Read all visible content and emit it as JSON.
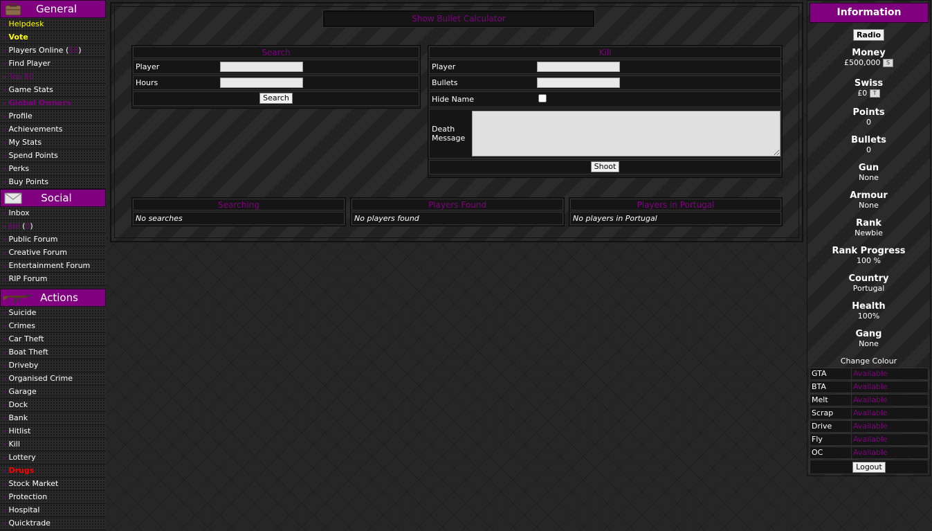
{
  "sidebar": {
    "general": {
      "title": "General",
      "items": {
        "helpdesk": "Helpdesk",
        "vote": "Vote",
        "players_online": "Players Online (",
        "players_online_count": "16",
        "players_online_close": ")",
        "find_player": "Find Player",
        "top10": "Top 10",
        "game_stats": "Game Stats",
        "global_owners": "Global Owners",
        "profile": "Profile",
        "achievements": "Achievements",
        "my_stats": "My Stats",
        "spend_points": "Spend Points",
        "perks": "Perks",
        "buy_points": "Buy Points"
      }
    },
    "social": {
      "title": "Social",
      "items": {
        "inbox": "Inbox",
        "jail": "Jail",
        "jail_open": " (",
        "jail_count": "0",
        "jail_close": ")",
        "public_forum": "Public Forum",
        "creative_forum": "Creative Forum",
        "entertainment_forum": "Entertainment Forum",
        "rip_forum": "RIP Forum"
      }
    },
    "actions": {
      "title": "Actions",
      "items": {
        "suicide": "Suicide",
        "crimes": "Crimes",
        "car_theft": "Car Theft",
        "boat_theft": "Boat Theft",
        "driveby": "Driveby",
        "organised_crime": "Organised Crime",
        "garage": "Garage",
        "dock": "Dock",
        "bank": "Bank",
        "hitlist": "Hitlist",
        "kill": "Kill",
        "lottery": "Lottery",
        "drugs": "Drugs",
        "stock_market": "Stock Market",
        "protection": "Protection",
        "hospital": "Hospital",
        "quicktrade": "Quicktrade"
      }
    },
    "arrow": "»"
  },
  "main": {
    "bullet_calc": "Show Bullet Calculator",
    "search_panel": {
      "title": "Search",
      "player_label": "Player",
      "hours_label": "Hours",
      "button": "Search"
    },
    "kill_panel": {
      "title": "Kill",
      "player_label": "Player",
      "bullets_label": "Bullets",
      "hide_name_label": "Hide Name",
      "death_message_label": "Death Message",
      "button": "Shoot"
    },
    "searching": {
      "title": "Searching",
      "value": "No searches"
    },
    "players_found": {
      "title": "Players Found",
      "value": "No players found"
    },
    "players_in_country": {
      "title": "Players in Portugal",
      "value": "No players in Portugal"
    }
  },
  "info": {
    "title": "Information",
    "radio": "Radio",
    "money": {
      "label": "Money",
      "value": "£500,000",
      "btn": "S"
    },
    "swiss": {
      "label": "Swiss",
      "value": "£0",
      "btn": "T"
    },
    "points": {
      "label": "Points",
      "value": "0"
    },
    "bullets": {
      "label": "Bullets",
      "value": "0"
    },
    "gun": {
      "label": "Gun",
      "value": "None"
    },
    "armour": {
      "label": "Armour",
      "value": "None"
    },
    "rank": {
      "label": "Rank",
      "value": "Newbie"
    },
    "rank_progress": {
      "label": "Rank Progress",
      "value": "100 %"
    },
    "country": {
      "label": "Country",
      "value": "Portugal"
    },
    "health": {
      "label": "Health",
      "value": "100%"
    },
    "gang": {
      "label": "Gang",
      "value": "None"
    },
    "change_colour": "Change Colour",
    "timers": [
      {
        "name": "GTA",
        "status": "Available"
      },
      {
        "name": "BTA",
        "status": "Available"
      },
      {
        "name": "Melt",
        "status": "Available"
      },
      {
        "name": "Scrap",
        "status": "Available"
      },
      {
        "name": "Drive",
        "status": "Available"
      },
      {
        "name": "Fly",
        "status": "Available"
      },
      {
        "name": "OC",
        "status": "Available"
      }
    ],
    "logout": "Logout"
  },
  "colors": {
    "accent": "#800080",
    "highlight": "#ffff00",
    "alert": "#ff0000"
  }
}
